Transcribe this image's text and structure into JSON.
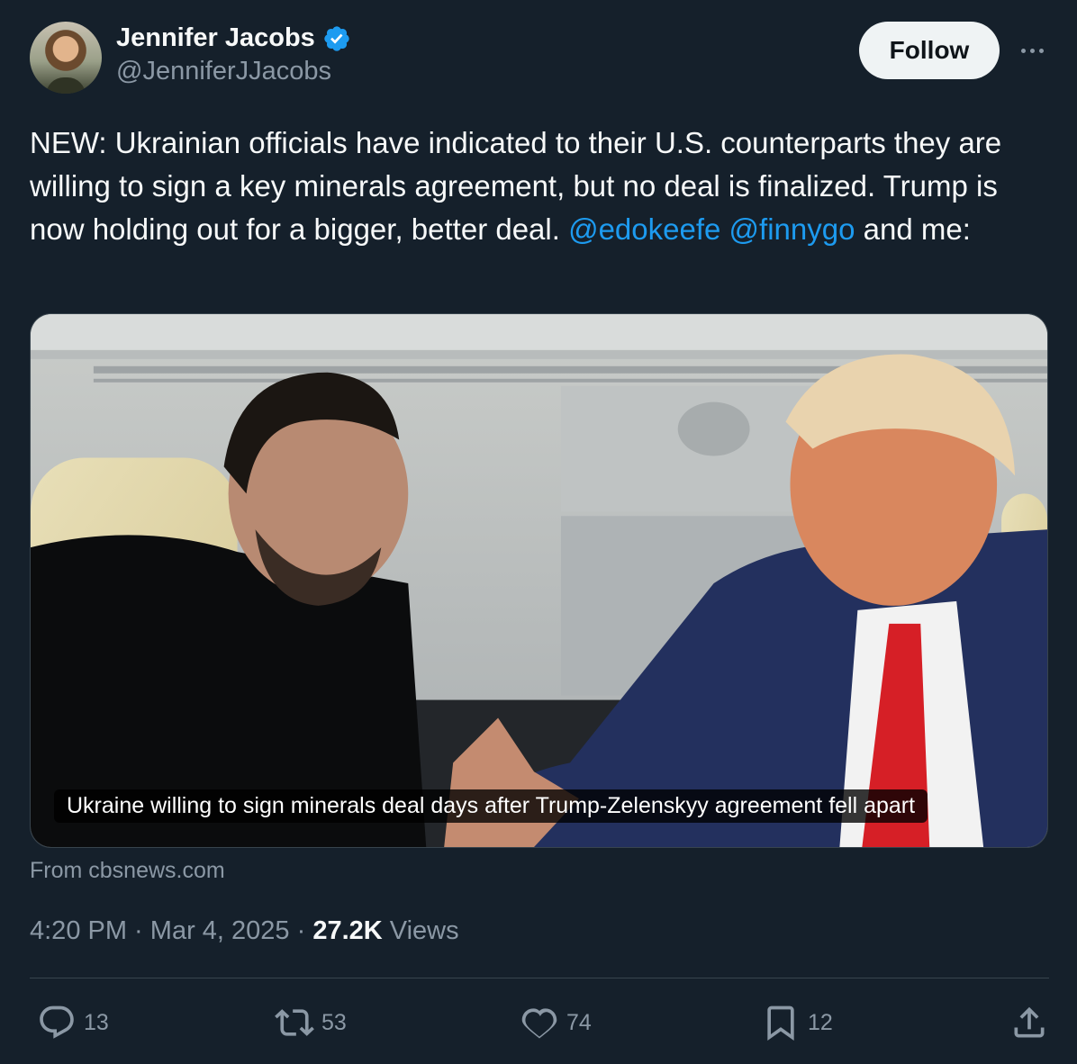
{
  "author": {
    "display_name": "Jennifer Jacobs",
    "handle": "@JenniferJJacobs",
    "verified": true
  },
  "follow_label": "Follow",
  "tweet": {
    "text_parts": [
      "NEW: Ukrainian officials have indicated to their U.S. counterparts they are willing to sign a key minerals agreement, but no deal is finalized. Trump is now holding out for a bigger, better deal. ",
      "@edokeefe",
      " ",
      "@finnygo",
      " and me:"
    ]
  },
  "link_card": {
    "caption": "Ukraine willing to sign minerals deal days after Trump-Zelenskyy agreement fell apart",
    "source": "From cbsnews.com"
  },
  "meta": {
    "time": "4:20 PM",
    "date": "Mar 4, 2025",
    "separator": " · ",
    "views_count": "27.2K",
    "views_label": "Views"
  },
  "actions": {
    "replies": "13",
    "reposts": "53",
    "likes": "74",
    "bookmarks": "12"
  },
  "colors": {
    "background": "#15202b",
    "text": "#f7f9f9",
    "secondary": "#8b98a5",
    "accent": "#1d9bf0",
    "border": "#38444d"
  },
  "icons": [
    "verified-badge-icon",
    "more-icon",
    "reply-icon",
    "repost-icon",
    "like-icon",
    "bookmark-icon",
    "share-icon"
  ]
}
